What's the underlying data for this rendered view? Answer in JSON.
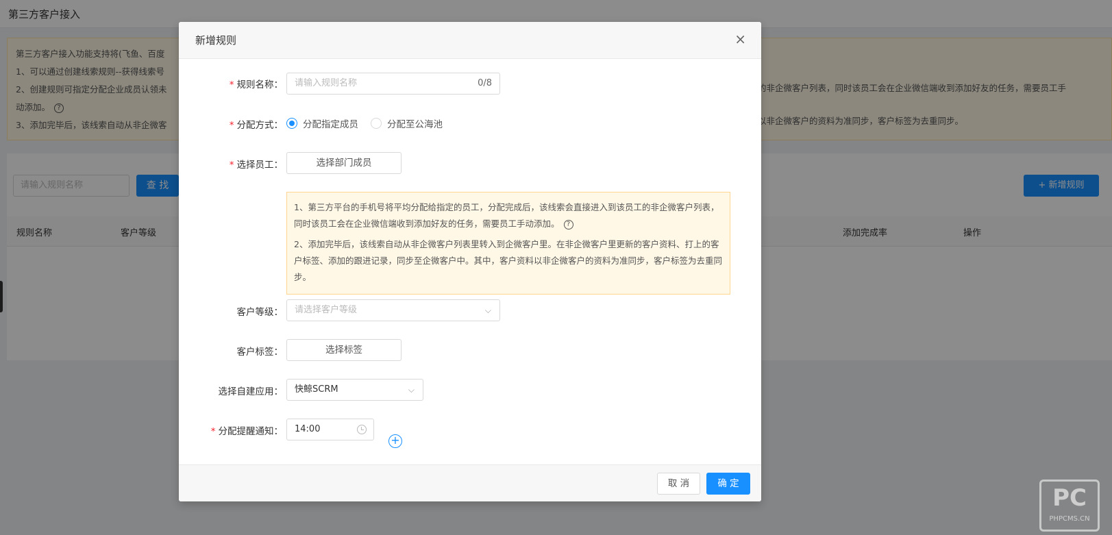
{
  "page": {
    "title": "第三方客户接入",
    "notice": [
      "第三方客户接入功能支持将(飞鱼、百度",
      "1、可以通过创建线索规则--获得线索号",
      "2、创建规则可指定分配企业成员认领未",
      "动添加。",
      "3、添加完毕后，该线索自动从非企微客"
    ],
    "notice_right": [
      "的非企微客户列表，同时该员工会在企业微信端收到添加好友的任务，需要员工手",
      "以非企微客户的资料为准同步，客户标签为去重同步。"
    ],
    "search_placeholder": "请输入规则名称",
    "search_label": "查 找",
    "add_label": "+ 新增规则",
    "table_headers": [
      "规则名称",
      "客户等级",
      "添加完成率",
      "操作"
    ]
  },
  "modal": {
    "title": "新增规则",
    "close": "×",
    "fields": {
      "rule_name": {
        "label": "规则名称：",
        "placeholder": "请输入规则名称",
        "counter": "0/8"
      },
      "assign_method": {
        "label": "分配方式：",
        "options": [
          "分配指定成员",
          "分配至公海池"
        ],
        "selected": "分配指定成员"
      },
      "select_staff": {
        "label": "选择员工：",
        "button": "选择部门成员"
      },
      "tip": [
        "1、第三方平台的手机号将平均分配给指定的员工，分配完成后，该线索会直接进入到该员工的非企微客户列表，同时该员工会在企业微信端收到添加好友的任务，需要员工手动添加。",
        "2、添加完毕后，该线索自动从非企微客户列表里转入到企微客户里。在非企微客户里更新的客户资料、打上的客户标签、添加的跟进记录，同步至企微客户中。其中，客户资料以非企微客户的资料为准同步，客户标签为去重同步。"
      ],
      "customer_level": {
        "label": "客户等级：",
        "placeholder": "请选择客户等级"
      },
      "customer_tag": {
        "label": "客户标签：",
        "button": "选择标签"
      },
      "app": {
        "label": "选择自建应用：",
        "value": "快鲸SCRM"
      },
      "notify": {
        "label": "分配提醒通知：",
        "value": "14:00"
      }
    },
    "footer": {
      "cancel": "取 消",
      "confirm": "确 定"
    }
  },
  "watermark": {
    "big": "PC",
    "small": "PHPCMS.CN"
  },
  "colors": {
    "primary": "#1890ff",
    "required": "#f5222d",
    "tip_bg": "#fff8e6"
  }
}
